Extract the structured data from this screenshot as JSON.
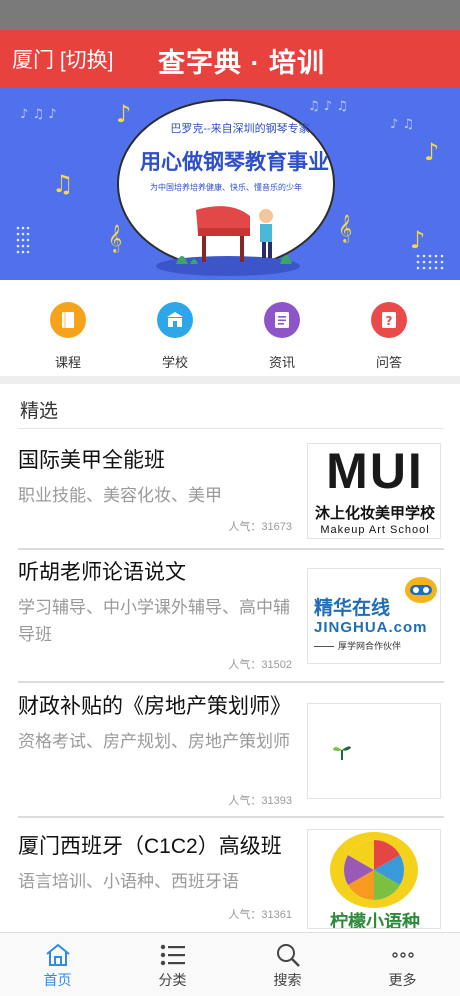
{
  "header": {
    "city": "厦门 [切换]",
    "title": "查字典 · 培训",
    "background": "#e8423f"
  },
  "banner": {
    "headline_small": "巴罗克--来自深圳的钢琴专家",
    "headline": "用心做钢琴教育事业",
    "subline": "为中国培养培养健康、快乐、懂音乐的少年",
    "background": "#4a6ce8"
  },
  "quick_nav": [
    {
      "label": "课程",
      "icon": "book-icon",
      "color": "#f7a21b"
    },
    {
      "label": "学校",
      "icon": "school-icon",
      "color": "#2ea7e8"
    },
    {
      "label": "资讯",
      "icon": "news-icon",
      "color": "#8e55c8"
    },
    {
      "label": "问答",
      "icon": "question-icon",
      "color": "#ea4a4a"
    }
  ],
  "section": {
    "title": "精选"
  },
  "courses": [
    {
      "title": "国际美甲全能班",
      "tags": "职业技能、美容化妆、美甲",
      "popularity": "人气：31673",
      "logo": {
        "mark": "MUI",
        "name": "沐上化妆美甲学校",
        "sub": "Makeup Art School"
      }
    },
    {
      "title": "听胡老师论语说文",
      "tags": "学习辅导、中小学课外辅导、高中辅导班",
      "popularity": "人气：31502",
      "logo": {
        "name": "精华在线",
        "domain": "JINGHUA.com",
        "sub": "厚学网合作伙伴"
      }
    },
    {
      "title": "财政补贴的《房地产策划师》",
      "tags": "资格考试、房产规划、房地产策划师",
      "popularity": "人气：31393",
      "logo": {}
    },
    {
      "title": "厦门西班牙（C1C2）高级班",
      "tags": "语言培训、小语种、西班牙语",
      "popularity": "人气：31361",
      "logo": {
        "name": "柠檬小语种"
      }
    }
  ],
  "tabbar": [
    {
      "label": "首页",
      "icon": "home-icon",
      "active": true
    },
    {
      "label": "分类",
      "icon": "list-icon",
      "active": false
    },
    {
      "label": "搜索",
      "icon": "search-icon",
      "active": false
    },
    {
      "label": "更多",
      "icon": "more-icon",
      "active": false
    }
  ],
  "colors": {
    "accent": "#2e8bea"
  }
}
